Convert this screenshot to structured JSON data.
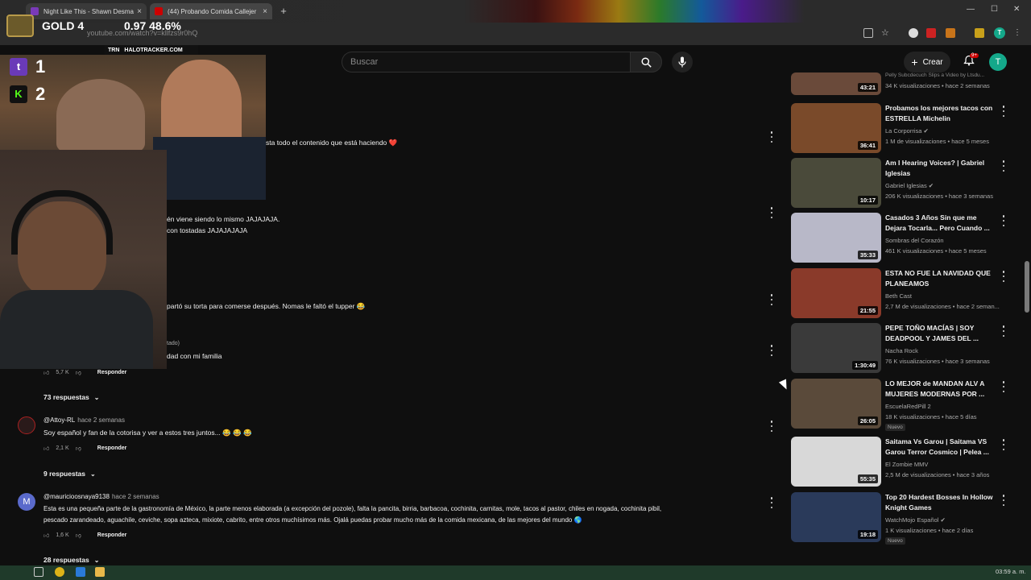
{
  "browser": {
    "tabs": [
      {
        "title": "Night Like This - Shawn Desma"
      },
      {
        "title": "(44) Probando Comida Callejer"
      }
    ],
    "url": "youtube.com/watch?v=kllfzs9r0hQ"
  },
  "overlay": {
    "rank": "GOLD 4",
    "stats": "0.97 48.6%",
    "banner_left": "TRN",
    "banner_right": "HALOTRACKER.COM",
    "score_twitch": "1",
    "score_kick": "2"
  },
  "header": {
    "search_placeholder": "Buscar",
    "create_label": "Crear",
    "notification_count": "9+",
    "account_initial": "T",
    "profile_initial": "T"
  },
  "comments": {
    "partial_lines": [
      "sta todo el contenido que está haciendo ❤️",
      "én viene siendo lo mismo JAJAJAJA.",
      "con tostadas JAJAJAJAJA",
      "partó su torta para comerse después. Nomas le faltó el tupper 😂",
      "tado)",
      "dad con mi familia"
    ],
    "partial_likes": "5,7 K",
    "reply_label": "Responder",
    "thread_1_replies": "73 respuestas",
    "items": [
      {
        "author": "@Attoy-RL",
        "time": "hace 2 semanas",
        "text": "Soy español y fan de la cotorisa y ver a estos tres juntos... 😂 😂 😂",
        "likes": "2,1 K",
        "replies": "9 respuestas"
      },
      {
        "author": "@mauricioosnaya9138",
        "time": "hace 2 semanas",
        "avatar": "M",
        "text_1": "Esta es una pequeña parte de la gastronomía de México, la parte menos elaborada (a excepción del pozole), falta la pancita, birria, barbacoa, cochinita, carnitas, mole, tacos al pastor, chiles en nogada, cochinita pibil,",
        "text_2": "pescado zarandeado, aguachile, ceviche, sopa azteca, mixiote, cabrito, entre otros muchísimos más. Ojalá puedas probar mucho más de la comida mexicana, de las mejores del mundo 🌎",
        "likes": "1,6 K",
        "replies": "28 respuestas"
      }
    ]
  },
  "related": [
    {
      "title": "",
      "channel": "",
      "meta": "34 K visualizaciones • hace 2 semanas",
      "duration": "43:21",
      "top_text": "Pelly Subcdecuch Slips a Video by Ltsdu..."
    },
    {
      "title": "Probamos los mejores tacos con ESTRELLA Michelin",
      "channel": "La Corporrisa ✔",
      "meta": "1 M de visualizaciones • hace 5 meses",
      "duration": "36:41",
      "color": "#7a4a2a"
    },
    {
      "title": "Am I Hearing Voices? | Gabriel Iglesias",
      "channel": "Gabriel Iglesias ✔",
      "meta": "206 K visualizaciones • hace 3 semanas",
      "duration": "10:17",
      "color": "#4a4a3a"
    },
    {
      "title": "Casados 3 Años Sin que me Dejara Tocarla... Pero Cuando ...",
      "channel": "Sombras del Corazón",
      "meta": "461 K visualizaciones • hace 5 meses",
      "duration": "35:33",
      "color": "#b8b8c8"
    },
    {
      "title": "ESTA NO FUE LA NAVIDAD QUE PLANEAMOS",
      "channel": "Beth Cast",
      "meta": "2,7 M de visualizaciones • hace 2 seman...",
      "duration": "21:55",
      "color": "#8a3a2a"
    },
    {
      "title": "PEPE TOÑO MACÍAS | SOY DEADPOOL Y JAMES DEL ...",
      "channel": "Nacha Rock",
      "meta": "76 K visualizaciones • hace 3 semanas",
      "duration": "1:30:49",
      "color": "#3a3a3a"
    },
    {
      "title": "LO MEJOR de MANDAN ALV A MUJERES MODERNAS POR ...",
      "channel": "EscuelaRedPill 2",
      "meta": "18 K visualizaciones • hace 5 días",
      "duration": "26:05",
      "badge": "Nuevo",
      "color": "#5a4a3a"
    },
    {
      "title": "Saitama Vs Garou | Saitama VS Garou Terror Cosmico | Pelea ...",
      "channel": "El Zombie MMV",
      "meta": "2,5 M de visualizaciones • hace 3 años",
      "duration": "55:35",
      "color": "#d8d8d8"
    },
    {
      "title": "Top 20 Hardest Bosses In Hollow Knight Games",
      "channel": "WatchMojo Español ✔",
      "meta": "1 K visualizaciones • hace 2 días",
      "duration": "19:18",
      "badge": "Nuevo",
      "color": "#2a3a5a"
    }
  ],
  "taskbar": {
    "clock": "03:59 a. m."
  },
  "colors": {
    "accent_teal": "#14a88a",
    "youtube_red": "#cc0000",
    "background": "#0f0f0f"
  }
}
